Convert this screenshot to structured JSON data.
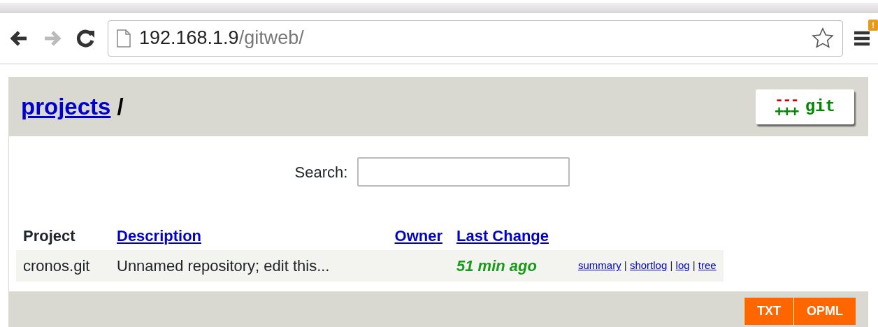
{
  "browser": {
    "url_host": "192.168.1.9",
    "url_path": "/gitweb/",
    "forward_disabled": true,
    "menu_badge": "!"
  },
  "header": {
    "breadcrumb_link": "projects",
    "separator": "/",
    "logo": {
      "minus": "---",
      "plus": "+++",
      "word": "git"
    }
  },
  "search": {
    "label": "Search:"
  },
  "table": {
    "columns": [
      {
        "label": "Project",
        "sortable": false
      },
      {
        "label": "Description",
        "sortable": true
      },
      {
        "label": "Owner",
        "sortable": true
      },
      {
        "label": "Last Change",
        "sortable": true
      }
    ],
    "rows": [
      {
        "project": "cronos.git",
        "description": "Unnamed repository; edit this...",
        "age": "51 min ago",
        "links": [
          "summary",
          "shortlog",
          "log",
          "tree"
        ],
        "separator": "|"
      }
    ]
  },
  "footer": {
    "feeds": [
      "TXT",
      "OPML"
    ]
  }
}
